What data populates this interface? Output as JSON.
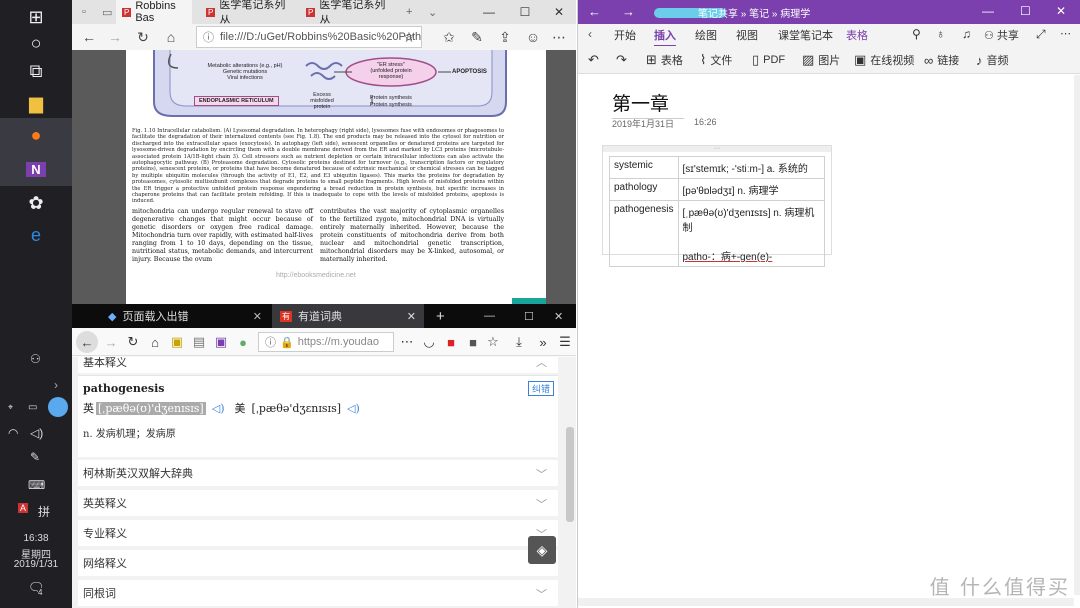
{
  "taskbar": {
    "time": "16:38",
    "weekday": "星期四",
    "date": "2019/1/31",
    "notification_count": "4"
  },
  "edge": {
    "tabs": [
      {
        "label": "Robbins Bas"
      },
      {
        "label": "医学笔记系列丛"
      },
      {
        "label": "医学笔记系列丛"
      }
    ],
    "url": "file:///D:/uGet/Robbins%20Basic%20Patholc",
    "pdf": {
      "diagram_items": [
        "Metabolic alterations (e.g., pH)",
        "Genetic mutations",
        "Viral infections",
        "\"ER stress\"",
        "(unfolded protein",
        "response)",
        "APOPTOSIS",
        "ENDOPLASMIC RETICULUM",
        "Excess",
        "misfolded",
        "protein",
        "Protein synthesis",
        "Protein synthesis"
      ],
      "caption": "Fig. 1.10 Intracellular catabolism. (A) Lysosomal degradation. In heterophagy (right side), lysosomes fuse with endosomes or phagosomes to facilitate the degradation of their internalized contents (see Fig. 1.8). The end products may be released into the cytosol for nutrition or discharged into the extracellular space (exocytosis). In autophagy (left side), senescent organelles or denatured proteins are targeted for lysosome-driven degradation by encircling them with a double membrane derived from the ER and marked by LC3 proteins (microtubule-associated protein 1A/1B-light chain 3). Cell stressors such as nutrient depletion or certain intracellular infections can also activate the autophagocytic pathway. (B) Proteasome degradation. Cytosolic proteins destined for turnover (e.g., transcription factors or regulatory proteins), senescent proteins, or proteins that have become denatured because of extrinsic mechanical or chemical stresses can be tagged by multiple ubiquitin molecules (through the activity of E1, E2, and E3 ubiquitin ligases). This marks the proteins for degradation by proteasomes, cytosolic multisubunit complexes that degrade proteins to small peptide fragments. High levels of misfolded proteins within the ER trigger a protective unfolded protein response engendering a broad reduction in protein synthesis, but specific increases in chaperone proteins that can facilitate protein refolding. If this is inadequate to cope with the levels of misfolded proteins, apoptosis is induced.",
      "col1": "mitochondria can undergo regular renewal to stave off degenerative changes that might occur because of genetic disorders or oxygen free radical damage. Mitochondria turn over rapidly, with estimated half-lives ranging from 1 to 10 days, depending on the tissue, nutritional status, metabolic demands, and intercurrent injury. Because the ovum",
      "col2": "contributes the vast majority of cytoplasmic organelles to the fertilized zygote, mitochondrial DNA is virtually entirely maternally inherited. However, because the protein constituents of mitochondria derive from both nuclear and mitochondrial genetic transcription, mitochondrial disorders may be X-linked, autosomal, or maternally inherited.",
      "footer": "http://ebooksmedicine.net"
    }
  },
  "firefox": {
    "tabs": [
      {
        "label": "页面载入出错"
      },
      {
        "label": "有道词典"
      }
    ],
    "url": "https://m.youdao",
    "dict": {
      "section_top": "基本释义",
      "word": "pathogenesis",
      "report_btn": "纠错",
      "uk_label": "英",
      "uk_phonetic": "[ˌpæθə(ʊ)'dʒenɪsɪs]",
      "us_label": "美",
      "us_phonetic": "[ˌpæθə'dʒɛnɪsɪs]",
      "definition": "n. 发病机理；发病原",
      "sections": [
        "柯林斯英汉双解大辞典",
        "英英释义",
        "专业释义",
        "网络释义",
        "同根词"
      ]
    }
  },
  "onenote": {
    "breadcrumb": "笔记共享 » 笔记 » 病理学",
    "ribbon_tabs": [
      "开始",
      "插入",
      "绘图",
      "视图",
      "课堂笔记本",
      "表格"
    ],
    "share_label": "共享",
    "ribbon_items": [
      "表格",
      "文件",
      "PDF",
      "图片",
      "在线视频",
      "链接",
      "音频"
    ],
    "page_title": "第一章",
    "page_date": "2019年1月31日",
    "page_time": "16:26",
    "rows": [
      {
        "term": "systemic",
        "def": "[sɪ'stemɪk; -'stiːm-] a. 系统的"
      },
      {
        "term": "pathology",
        "def": "[pə'θɒlədʒɪ] n. 病理学"
      },
      {
        "term": "pathogenesis",
        "def": "[ˌpæθə(ʊ)'dʒenɪsɪs] n. 病理机制",
        "note": "patho-：病+-gen(e)-"
      }
    ]
  },
  "watermark": "值 什么值得买"
}
